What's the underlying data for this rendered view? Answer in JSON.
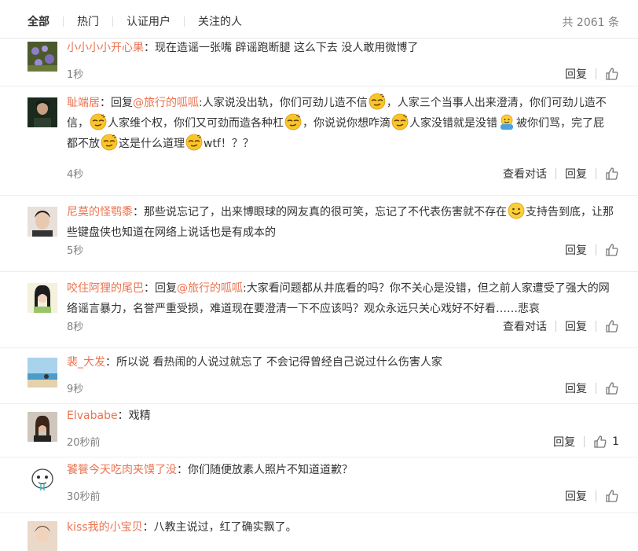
{
  "tabs": [
    "全部",
    "热门",
    "认证用户",
    "关注的人"
  ],
  "total": "共 2061 条",
  "reply_label": "回复",
  "dialog_label": "查看对话",
  "colors": {
    "accent": "#eb7350",
    "muted": "#808080"
  },
  "comments": [
    {
      "user": "小小小小开心果",
      "sep": "：",
      "text": "现在造谣一张嘴 辟谣跑断腿 这么下去 没人敢用微博了",
      "time": "1秒"
    },
    {
      "user": "耻端居",
      "sep": "：",
      "reply_prefix": "回复",
      "mention": "@旅行的呱呱",
      "p1": ":人家说没出轨，你们可劲儿造不信",
      "p2": "，人家三个当事人出来澄清，你们可劲儿造不信，",
      "p3": "人家维个权，你们又可劲而造各种杠",
      "p4": "，你说说你想咋滴",
      "p5": "人家没错就是没错",
      "p6": "被你们骂，完了屁都不放",
      "p7": "这是什么道理",
      "p8": "wtf！？？",
      "time": "4秒"
    },
    {
      "user": "尼莫的怪鹗黍",
      "sep": "：",
      "p1": "那些说忘记了，出来博眼球的网友真的很可笑，忘记了不代表伤害就不存在",
      "p2": "支持告到底，让那些键盘侠也知道在网络上说话也是有成本的",
      "time": "5秒"
    },
    {
      "user": "咬住阿狸的尾巴",
      "sep": "：",
      "reply_prefix": "回复",
      "mention": "@旅行的呱呱",
      "p1": ":大家看问题都从井底看的吗？你不关心是没错，但之前人家遭受了强大的网络谣言暴力，名誉严重受损，难道现在要澄清一下不应该吗？观众永远只关心戏好不好看……悲哀",
      "time": "8秒"
    },
    {
      "user": "裴_大发",
      "sep": "：",
      "text": "所以说 看热闹的人说过就忘了 不会记得曾经自己说过什么伤害人家",
      "time": "9秒"
    },
    {
      "user": "Elvababe",
      "sep": "：",
      "text": "戏精",
      "time": "20秒前",
      "likes": "1"
    },
    {
      "user": "饕餮今天吃肉夹馍了没",
      "sep": "：",
      "text": "你们随便放素人照片不知道道歉？",
      "time": "30秒前"
    },
    {
      "user": "kiss我的小宝贝",
      "sep": "：",
      "text": "八教主说过，红了确实飘了。"
    }
  ]
}
